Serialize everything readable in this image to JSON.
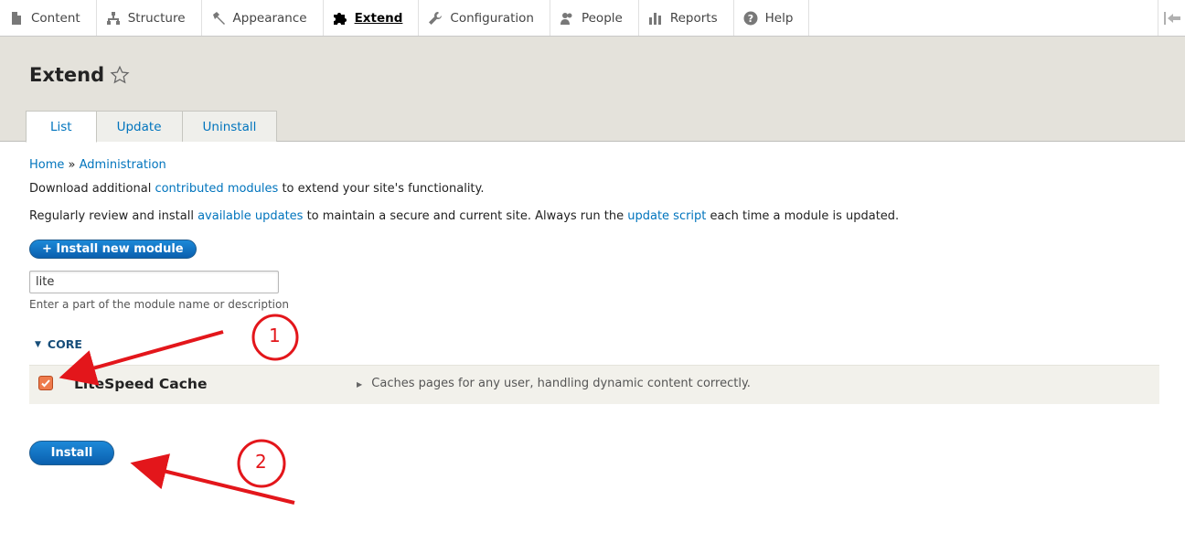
{
  "toolbar": {
    "items": [
      {
        "label": "Content",
        "icon": "file-icon"
      },
      {
        "label": "Structure",
        "icon": "sitemap-icon"
      },
      {
        "label": "Appearance",
        "icon": "wrench-paint-icon"
      },
      {
        "label": "Extend",
        "icon": "puzzle-icon",
        "active": true
      },
      {
        "label": "Configuration",
        "icon": "wrench-icon"
      },
      {
        "label": "People",
        "icon": "people-icon"
      },
      {
        "label": "Reports",
        "icon": "bar-chart-icon"
      },
      {
        "label": "Help",
        "icon": "help-icon"
      }
    ],
    "toggle_icon": "collapse-toolbar-icon"
  },
  "header": {
    "title": "Extend",
    "tabs": [
      {
        "label": "List",
        "active": true
      },
      {
        "label": "Update"
      },
      {
        "label": "Uninstall"
      }
    ]
  },
  "breadcrumb": {
    "home": "Home",
    "separator": "»",
    "admin": "Administration"
  },
  "intro": {
    "p1_before": "Download additional ",
    "p1_link": "contributed modules",
    "p1_after": " to extend your site's functionality.",
    "p2_before": "Regularly review and install ",
    "p2_link1": "available updates",
    "p2_middle": " to maintain a secure and current site. Always run the ",
    "p2_link2": "update script",
    "p2_after": " each time a module is updated."
  },
  "install_new_label": "+ Install new module",
  "filter": {
    "value": "lite",
    "description": "Enter a part of the module name or description"
  },
  "group": {
    "label": "CORE"
  },
  "module": {
    "name": "LiteSpeed Cache",
    "description": "Caches pages for any user, handling dynamic content correctly.",
    "checked": true
  },
  "install_label": "Install",
  "annotations": {
    "step1": "1",
    "step2": "2",
    "color": "#e3161b"
  },
  "colors": {
    "link": "#0074bd",
    "button": "#0a6bbf",
    "header_bg": "#e4e2db",
    "checkbox": "#ee7b4c"
  }
}
